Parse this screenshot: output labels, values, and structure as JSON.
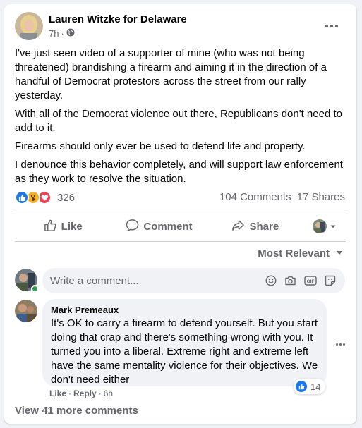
{
  "post": {
    "author": "Lauren Witzke for Delaware",
    "time": "7h",
    "separator": "·",
    "paragraphs": [
      "I've just seen video of a supporter of mine (who was not being threatened) brandishing a firearm and aiming it in the direction of a handful of Democrat protestors across the street from our rally yesterday.",
      "With all of the Democrat violence out there, Republicans don't need to add to it.",
      "Firearms should only ever be used to defend life and property.",
      "I denounce this behavior completely, and will support law enforcement as they work to resolve the situation."
    ],
    "reaction_count": "326",
    "comments_count": "104 Comments",
    "shares_count": "17 Shares",
    "icons": {
      "privacy": "globe-icon",
      "more": "more-options-icon",
      "reactions": [
        "like-reaction-icon",
        "wow-reaction-icon",
        "love-reaction-icon"
      ]
    }
  },
  "actions": {
    "like": "Like",
    "comment": "Comment",
    "share": "Share"
  },
  "comments_section": {
    "sort_label": "Most Relevant",
    "composer_placeholder": "Write a comment...",
    "composer_icons": [
      "emoji-icon",
      "camera-icon",
      "gif-icon",
      "sticker-icon"
    ],
    "comments": [
      {
        "name": "Mark Premeaux",
        "text": "It's OK to carry a firearm to defend yourself. But you start doing that crap and there's something wrong with you. It turned you into a liberal. Extreme right and extreme left have the same mentality violence for their objectives. We don't need either",
        "like_count": "14",
        "like_action": "Like",
        "reply_action": "Reply",
        "time": "6h"
      }
    ],
    "view_more": "View 41 more comments"
  },
  "colors": {
    "background": "#f0f2f5",
    "card": "#ffffff",
    "secondary_text": "#65676b",
    "like_blue": "#1877f2",
    "love_red": "#f33e58",
    "wow_yellow": "#f7b125",
    "online_green": "#31a24c"
  }
}
